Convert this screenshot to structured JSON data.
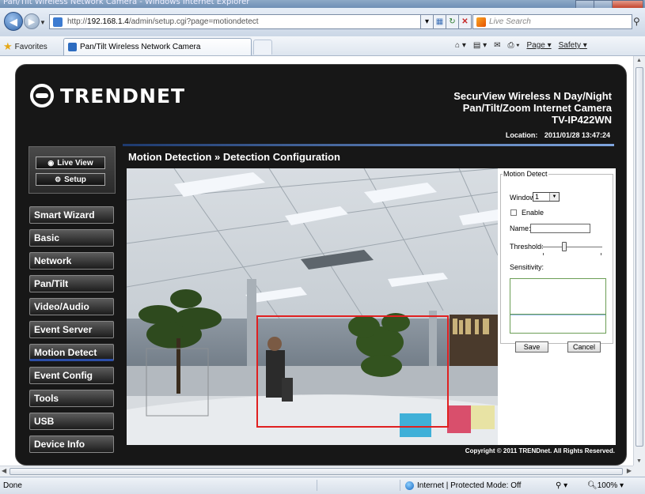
{
  "browser": {
    "title": "Pan/Tilt Wireless Network Camera - Windows Internet Explorer",
    "url_prefix": "http://",
    "url_host": "192.168.1.4",
    "url_path": "/admin/setup.cgi?page=motiondetect",
    "search_placeholder": "Live Search",
    "favorites_label": "Favorites",
    "tab_title": "Pan/Tilt Wireless Network Camera",
    "toolbar": {
      "page_label": "Page ▾",
      "safety_label": "Safety ▾"
    },
    "status_text": "Done",
    "zone_text": "Internet | Protected Mode: Off",
    "zoom_text": "100%"
  },
  "camera_ui": {
    "brand": "TRENDNET",
    "product_line1": "SecurView Wireless N Day/Night",
    "product_line2": "Pan/Tilt/Zoom Internet Camera",
    "model": "TV-IP422WN",
    "location_label": "Location:",
    "datetime": "2011/01/28 13:47:24",
    "page_header": "Motion Detection » Detection Configuration",
    "live_view_label": "Live View",
    "setup_label": "Setup",
    "menu": [
      "Smart Wizard",
      "Basic",
      "Network",
      "Pan/Tilt",
      "Video/Audio",
      "Event Server",
      "Motion Detect",
      "Event Config",
      "Tools",
      "USB",
      "Device Info"
    ],
    "active_menu": "Motion Detect",
    "copyright": "Copyright © 2011 TRENDnet. All Rights Reserved."
  },
  "motion_panel": {
    "legend": "Motion Detect",
    "window_label": "Window:",
    "window_value": "1",
    "enable_label": "Enable",
    "enable_checked": false,
    "name_label": "Name:",
    "name_value": "",
    "threshold_label": "Threshold:",
    "threshold_level": 0.4,
    "sensitivity_label": "Sensitivity:",
    "save_label": "Save",
    "cancel_label": "Cancel"
  },
  "colors": {
    "page_bg": "#171717",
    "accent_blue": "#2c4ea8",
    "detection_window": "#e02020",
    "sensitivity_border": "#6b9e55"
  }
}
